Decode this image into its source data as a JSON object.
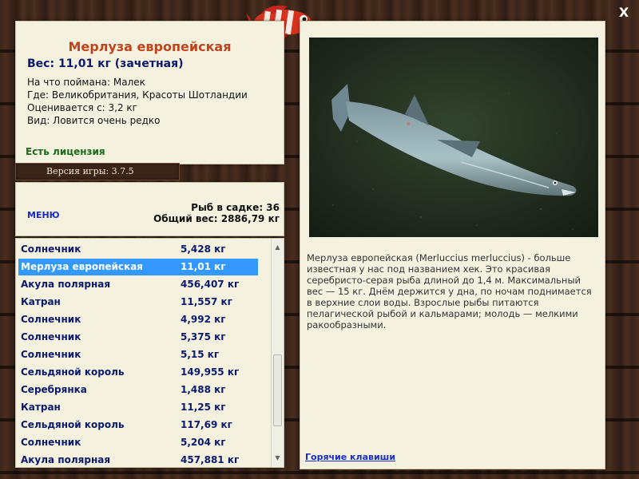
{
  "fish": {
    "name": "Мерлуза европейская",
    "weight": "Вес: 11,01 кг (зачетная)",
    "bait": "На что поймана: Малек",
    "location": "Где: Великобритания, Красоты Шотландии",
    "valued_from": "Оценивается с: 3,2 кг",
    "kind": "Вид: Ловится очень редко",
    "license": "Есть лицензия"
  },
  "version_label": "Версия игры: 3.7.5",
  "menu_label": "МЕНЮ",
  "stats": {
    "count": "Рыб в садке: 36",
    "total_weight": "Общий вес: 2886,79 кг"
  },
  "catch_list": [
    {
      "name": "Солнечник",
      "weight": "5,428 кг"
    },
    {
      "name": "Мерлуза европейская",
      "weight": "11,01 кг",
      "selected": true
    },
    {
      "name": "Акула полярная",
      "weight": "456,407 кг"
    },
    {
      "name": "Катран",
      "weight": "11,557 кг"
    },
    {
      "name": "Солнечник",
      "weight": "4,992 кг"
    },
    {
      "name": "Солнечник",
      "weight": "5,375 кг"
    },
    {
      "name": "Солнечник",
      "weight": "5,15 кг"
    },
    {
      "name": "Сельдяной король",
      "weight": "149,955 кг"
    },
    {
      "name": "Серебрянка",
      "weight": "1,488 кг"
    },
    {
      "name": "Катран",
      "weight": "11,25 кг"
    },
    {
      "name": "Сельдяной король",
      "weight": "117,69 кг"
    },
    {
      "name": "Солнечник",
      "weight": "5,204 кг"
    },
    {
      "name": "Акула полярная",
      "weight": "457,881 кг"
    }
  ],
  "description": "Мерлуза европейская (Merluccius merluccius) - больше известная у нас под названием хек. Это красивая серебристо-серая рыба длиной до 1,4 м. Максимальный вес — 15 кг. Днём держится у дна, по ночам поднимается в верхние слои воды. Взрослые рыбы питаются пелагической рыбой и кальмарами; молодь — мелкими ракообразными.",
  "hotkeys_label": "Горячие клавиши",
  "close_label": "X",
  "icons": {
    "close": "close-icon",
    "logo": "fish-logo-icon",
    "scroll_up": "chevron-up-icon",
    "scroll_down": "chevron-down-icon"
  }
}
